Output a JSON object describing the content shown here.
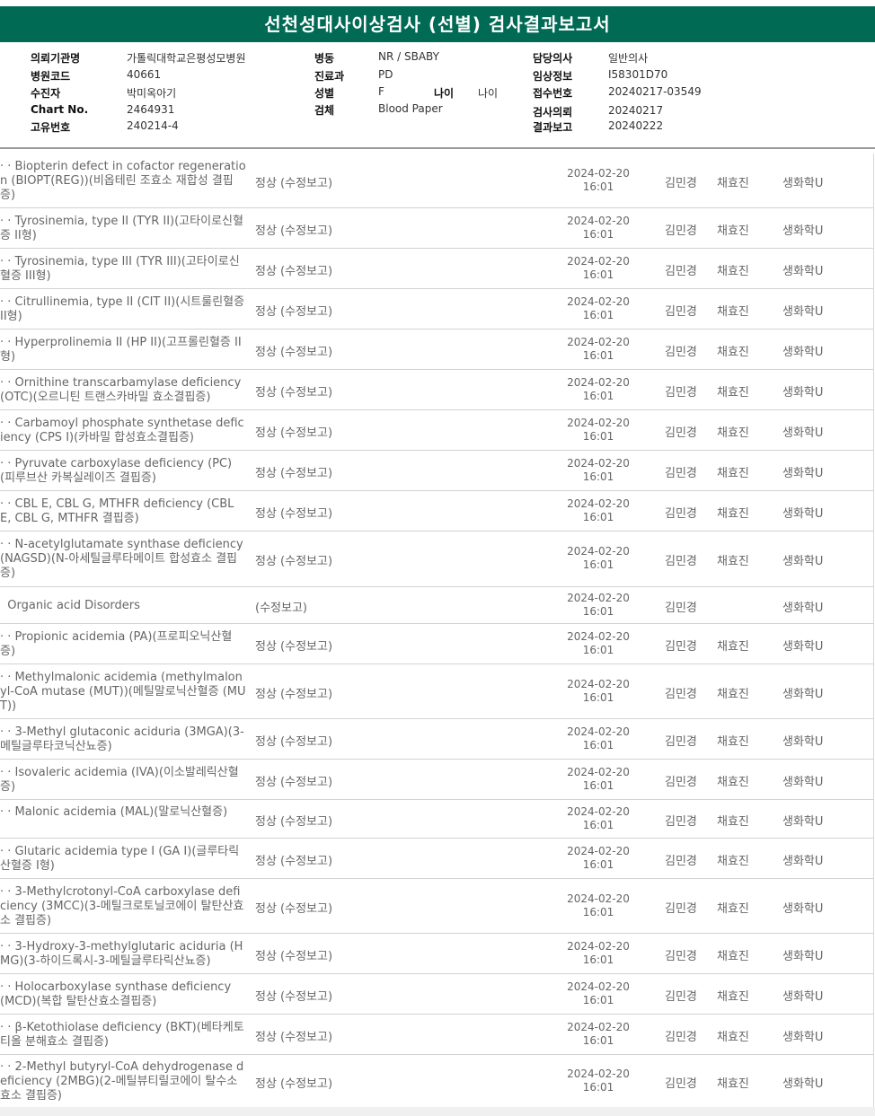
{
  "title": "선천성대사이상검사 (선별) 검사결과보고서",
  "info": {
    "col1": [
      {
        "label": "의뢰기관명",
        "value": "가톨릭대학교은평성모병원"
      },
      {
        "label": "병원코드",
        "value": "40661"
      },
      {
        "label": "수진자",
        "value": "박미옥아기"
      },
      {
        "label": "Chart No.",
        "value": "2464931"
      },
      {
        "label": "고유번호",
        "value": "240214-4"
      }
    ],
    "col2": [
      {
        "label": "병동",
        "value": "NR / SBABY"
      },
      {
        "label": "진료과",
        "value": "PD"
      },
      {
        "label": "성별",
        "value": "F"
      },
      {
        "label": "검체",
        "value": "Blood Paper"
      }
    ],
    "age_label": "나이",
    "age_value": "나이",
    "col3": [
      {
        "label": "담당의사",
        "value": "일반의사"
      },
      {
        "label": "임상정보",
        "value": "I58301D70"
      },
      {
        "label": "접수번호",
        "value": "20240217-03549"
      },
      {
        "label": "검사의뢰",
        "value": "20240217"
      },
      {
        "label": "결과보고",
        "value": "20240222"
      }
    ]
  },
  "rows": [
    {
      "name": "· · Biopterin defect in cofactor regeneration (BIOPT(REG))(비옵테린 조효소 재합성 결핍증)",
      "result": "정상 (수정보고)",
      "date": "2024-02-20",
      "time": "16:01",
      "tester": "김민경",
      "checker": "채효진",
      "dept": "생화학U"
    },
    {
      "name": "· · Tyrosinemia, type II (TYR II)(고타이로신혈증 II형)",
      "result": "정상 (수정보고)",
      "date": "2024-02-20",
      "time": "16:01",
      "tester": "김민경",
      "checker": "채효진",
      "dept": "생화학U"
    },
    {
      "name": "· · Tyrosinemia, type III (TYR III)(고타이로신혈증 III형)",
      "result": "정상 (수정보고)",
      "date": "2024-02-20",
      "time": "16:01",
      "tester": "김민경",
      "checker": "채효진",
      "dept": "생화학U"
    },
    {
      "name": "· · Citrullinemia, type II (CIT II)(시트룰린혈증 II형)",
      "result": "정상 (수정보고)",
      "date": "2024-02-20",
      "time": "16:01",
      "tester": "김민경",
      "checker": "채효진",
      "dept": "생화학U"
    },
    {
      "name": "· · Hyperprolinemia II (HP II)(고프롤린혈증 II형)",
      "result": "정상 (수정보고)",
      "date": "2024-02-20",
      "time": "16:01",
      "tester": "김민경",
      "checker": "채효진",
      "dept": "생화학U"
    },
    {
      "name": "· · Ornithine transcarbamylase deficiency (OTC)(오르니틴 트랜스카바밀 효소결핍증)",
      "result": "정상 (수정보고)",
      "date": "2024-02-20",
      "time": "16:01",
      "tester": "김민경",
      "checker": "채효진",
      "dept": "생화학U"
    },
    {
      "name": "· · Carbamoyl phosphate synthetase deficiency (CPS I)(카바밀 합성효소결핍증)",
      "result": "정상 (수정보고)",
      "date": "2024-02-20",
      "time": "16:01",
      "tester": "김민경",
      "checker": "채효진",
      "dept": "생화학U"
    },
    {
      "name": "· · Pyruvate carboxylase deficiency (PC)(피루브산 카복실레이즈 결핍증)",
      "result": "정상 (수정보고)",
      "date": "2024-02-20",
      "time": "16:01",
      "tester": "김민경",
      "checker": "채효진",
      "dept": "생화학U"
    },
    {
      "name": "· · CBL E, CBL G, MTHFR deficiency (CBL E, CBL G, MTHFR 결핍증)",
      "result": "정상 (수정보고)",
      "date": "2024-02-20",
      "time": "16:01",
      "tester": "김민경",
      "checker": "채효진",
      "dept": "생화학U"
    },
    {
      "name": "· · N-acetylglutamate synthase deficiency (NAGSD)(N-아세틸글루타메이트 합성효소 결핍증)",
      "result": "정상 (수정보고)",
      "date": "2024-02-20",
      "time": "16:01",
      "tester": "김민경",
      "checker": "채효진",
      "dept": "생화학U"
    },
    {
      "name": "  Organic acid Disorders",
      "result": "(수정보고)",
      "date": "2024-02-20",
      "time": "16:01",
      "tester": "김민경",
      "checker": "",
      "dept": "생화학U"
    },
    {
      "name": "· · Propionic acidemia (PA)(프로피오닉산혈증)",
      "result": "정상 (수정보고)",
      "date": "2024-02-20",
      "time": "16:01",
      "tester": "김민경",
      "checker": "채효진",
      "dept": "생화학U"
    },
    {
      "name": "· · Methylmalonic acidemia (methylmalonyl-CoA mutase (MUT))(메틸말로닉산혈증 (MUT))",
      "result": "정상 (수정보고)",
      "date": "2024-02-20",
      "time": "16:01",
      "tester": "김민경",
      "checker": "채효진",
      "dept": "생화학U"
    },
    {
      "name": "· · 3-Methyl glutaconic aciduria (3MGA)(3-메틸글루타코닉산뇨증)",
      "result": "정상 (수정보고)",
      "date": "2024-02-20",
      "time": "16:01",
      "tester": "김민경",
      "checker": "채효진",
      "dept": "생화학U"
    },
    {
      "name": "· · Isovaleric acidemia (IVA)(이소발레릭산혈증)",
      "result": "정상 (수정보고)",
      "date": "2024-02-20",
      "time": "16:01",
      "tester": "김민경",
      "checker": "채효진",
      "dept": "생화학U"
    },
    {
      "name": "· · Malonic acidemia (MAL)(말로닉산혈증)",
      "result": "정상 (수정보고)",
      "date": "2024-02-20",
      "time": "16:01",
      "tester": "김민경",
      "checker": "채효진",
      "dept": "생화학U"
    },
    {
      "name": "· · Glutaric acidemia type I (GA I)(글루타릭산혈증 I형)",
      "result": "정상 (수정보고)",
      "date": "2024-02-20",
      "time": "16:01",
      "tester": "김민경",
      "checker": "채효진",
      "dept": "생화학U"
    },
    {
      "name": "· · 3-Methylcrotonyl-CoA carboxylase deficiency (3MCC)(3-메틸크로토닐코에이 탈탄산효소 결핍증)",
      "result": "정상 (수정보고)",
      "date": "2024-02-20",
      "time": "16:01",
      "tester": "김민경",
      "checker": "채효진",
      "dept": "생화학U"
    },
    {
      "name": "· · 3-Hydroxy-3-methylglutaric aciduria (HMG)(3-하이드록시-3-메틸글루타릭산뇨증)",
      "result": "정상 (수정보고)",
      "date": "2024-02-20",
      "time": "16:01",
      "tester": "김민경",
      "checker": "채효진",
      "dept": "생화학U"
    },
    {
      "name": "· · Holocarboxylase synthase deficiency (MCD)(복합 탈탄산효소결핍증)",
      "result": "정상 (수정보고)",
      "date": "2024-02-20",
      "time": "16:01",
      "tester": "김민경",
      "checker": "채효진",
      "dept": "생화학U"
    },
    {
      "name": "· · β-Ketothiolase deficiency (BKT)(베타케토티올 분해효소 결핍증)",
      "result": "정상 (수정보고)",
      "date": "2024-02-20",
      "time": "16:01",
      "tester": "김민경",
      "checker": "채효진",
      "dept": "생화학U"
    },
    {
      "name": "· · 2-Methyl butyryl-CoA dehydrogenase deficiency (2MBG)(2-메틸뷰티릴코에이 탈수소효소 결핍증)",
      "result": "정상 (수정보고)",
      "date": "2024-02-20",
      "time": "16:01",
      "tester": "김민경",
      "checker": "채효진",
      "dept": "생화학U"
    }
  ]
}
